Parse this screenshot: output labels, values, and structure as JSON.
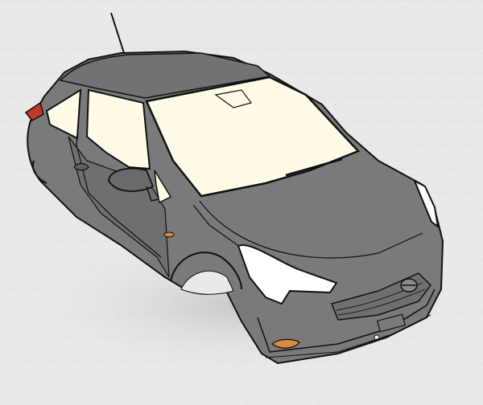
{
  "scene": {
    "background_color": "#e9e9e9",
    "grid_color": "#dcdcdc",
    "body_color": "#7a7a7a",
    "body_shade_color": "#6a6a6a",
    "glass_color": "#fffbe6",
    "outline_color": "#111111",
    "headlight_color": "#ffffff",
    "taillight_color": "#c0392b",
    "indicator_color": "#d98a3a"
  },
  "car": {
    "grille_emblem": "logo"
  }
}
